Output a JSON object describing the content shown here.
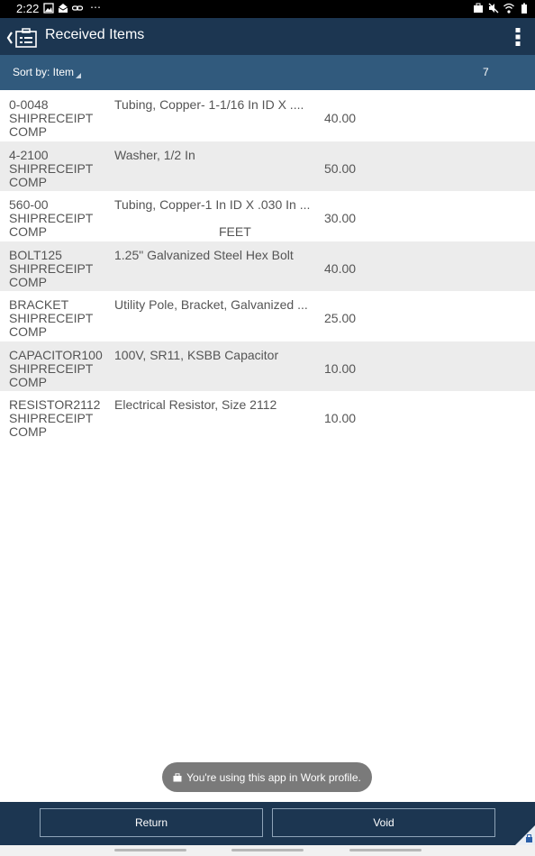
{
  "status": {
    "time": "2:22",
    "overflow": "⋯",
    "left_icons": [
      "gallery-icon",
      "mail-icon",
      "link-icon"
    ],
    "right_icons": [
      "work-profile-icon",
      "mute-icon",
      "wifi-icon",
      "battery-icon"
    ]
  },
  "header": {
    "title": "Received Items",
    "back_icon": "back-chevron-icon",
    "app_icon": "items-clipboard-icon",
    "menu_icon": "more-vert-icon"
  },
  "sortbar": {
    "label": "Sort by: Item",
    "count": "7"
  },
  "rows": [
    {
      "item": "0-0048",
      "status": "SHIPRECEIPT",
      "sub": "COMP",
      "desc": "Tubing, Copper- 1-1/16 In ID X ....",
      "qty": "40.00",
      "uom": ""
    },
    {
      "item": "4-2100",
      "status": "SHIPRECEIPT",
      "sub": "COMP",
      "desc": "Washer, 1/2 In",
      "qty": "50.00",
      "uom": ""
    },
    {
      "item": "560-00",
      "status": "SHIPRECEIPT",
      "sub": "COMP",
      "desc": "Tubing, Copper-1 In ID X .030 In ...",
      "qty": "30.00",
      "uom": "FEET"
    },
    {
      "item": "BOLT125",
      "status": "SHIPRECEIPT",
      "sub": "COMP",
      "desc": "1.25\" Galvanized Steel Hex Bolt",
      "qty": "40.00",
      "uom": ""
    },
    {
      "item": "BRACKET",
      "status": "SHIPRECEIPT",
      "sub": "COMP",
      "desc": "Utility Pole, Bracket, Galvanized ...",
      "qty": "25.00",
      "uom": ""
    },
    {
      "item": "CAPACITOR100",
      "status": "SHIPRECEIPT",
      "sub": "COMP",
      "desc": "100V, SR11, KSBB Capacitor",
      "qty": "10.00",
      "uom": ""
    },
    {
      "item": "RESISTOR2112",
      "status": "SHIPRECEIPT",
      "sub": "COMP",
      "desc": "Electrical Resistor, Size 2112",
      "qty": "10.00",
      "uom": ""
    }
  ],
  "toast": {
    "text": "You're using this app in Work profile.",
    "icon": "briefcase-lock-icon"
  },
  "footer": {
    "return_label": "Return",
    "void_label": "Void"
  },
  "colors": {
    "appbar": "#1c3651",
    "sortbar": "#315a7d",
    "row_alt": "#ececec"
  }
}
